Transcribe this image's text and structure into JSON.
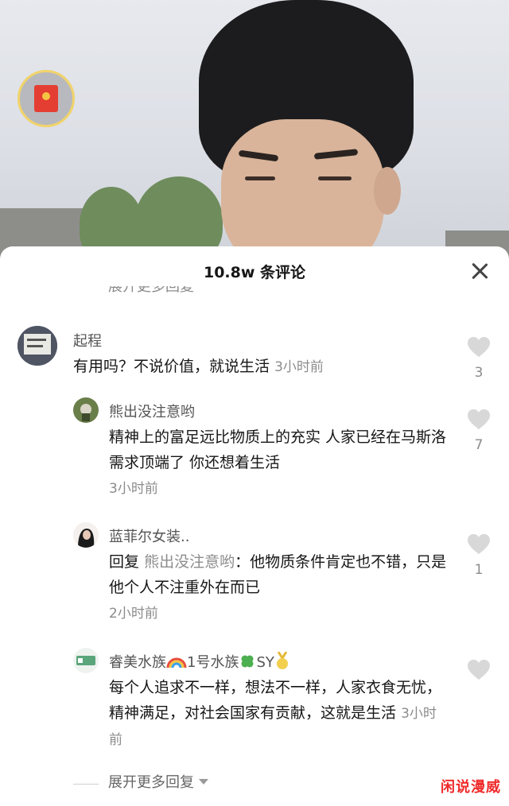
{
  "header": {
    "title": "10.8w 条评论",
    "truncated_reply_label": "展开更多回复"
  },
  "comments": [
    {
      "username": "起程",
      "text": "有用吗？不说价值，就说生活",
      "time": "3小时前",
      "likes": "3"
    },
    {
      "username": "熊出没注意哟",
      "text": "精神上的富足远比物质上的充实 人家已经在马斯洛需求顶端了 你还想着生活",
      "time": "3小时前",
      "likes": "7"
    },
    {
      "username": "蓝菲尔女装..",
      "reply_prefix": "回复",
      "reply_target": "熊出没注意哟",
      "text": "：他物质条件肯定也不错，只是他个人不注重外在而已",
      "time": "2小时前",
      "likes": "1"
    },
    {
      "username_part1": "睿美水族",
      "username_part2": "1号水族",
      "username_part3": "SY",
      "text": "每个人追求不一样，想法不一样，人家衣食无忧，精神满足，对社会国家有贡献，这就是生活",
      "time": "3小时前",
      "likes": ""
    }
  ],
  "footer": {
    "expand_label": "展开更多回复",
    "watermark": "闲说漫威"
  },
  "colors": {
    "like_icon": "#d8d8d8",
    "watermark": "#ef2b2b",
    "red_packet": "#e43d32"
  },
  "icons": [
    "red-packet-icon",
    "close-icon",
    "heart-icon",
    "chevron-down-icon",
    "rainbow-icon",
    "clover-icon",
    "medal-icon"
  ]
}
